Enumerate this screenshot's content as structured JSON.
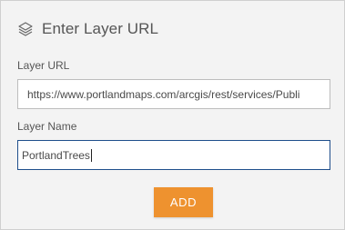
{
  "header": {
    "icon": "layers-icon",
    "title": "Enter Layer URL"
  },
  "layer_url": {
    "label": "Layer URL",
    "value": "https://www.portlandmaps.com/arcgis/rest/services/Publi"
  },
  "layer_name": {
    "label": "Layer Name",
    "value": "PortlandTrees"
  },
  "actions": {
    "add_label": "ADD"
  },
  "colors": {
    "accent": "#ee922f",
    "focus_border": "#1f4f8c",
    "panel_bg": "#f3f3f3"
  }
}
